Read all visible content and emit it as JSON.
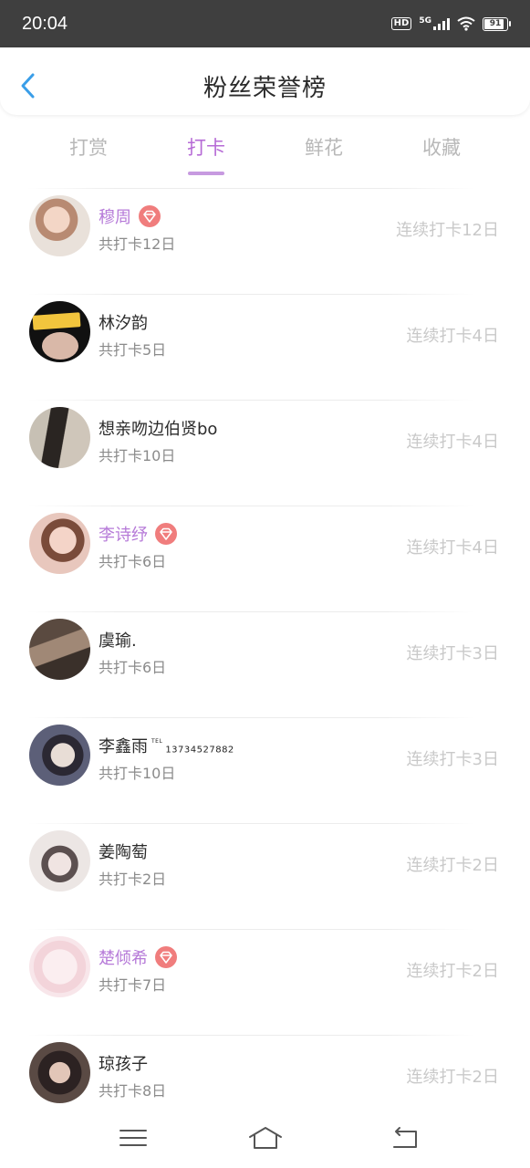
{
  "status_bar": {
    "time": "20:04",
    "network": "5G",
    "hd": "HD",
    "battery": "91"
  },
  "header": {
    "title": "粉丝荣誉榜"
  },
  "tabs": [
    {
      "label": "打赏",
      "active": false
    },
    {
      "label": "打卡",
      "active": true
    },
    {
      "label": "鲜花",
      "active": false
    },
    {
      "label": "收藏",
      "active": false
    }
  ],
  "fans": [
    {
      "name": "穆周",
      "vip": true,
      "total": "共打卡12日",
      "streak": "连续打卡12日"
    },
    {
      "name": "林汐韵",
      "vip": false,
      "total": "共打卡5日",
      "streak": "连续打卡4日"
    },
    {
      "name": "想亲吻边伯贤bo",
      "vip": false,
      "total": "共打卡10日",
      "streak": "连续打卡4日"
    },
    {
      "name": "李诗纾",
      "vip": true,
      "total": "共打卡6日",
      "streak": "连续打卡4日"
    },
    {
      "name": "虞瑜.",
      "vip": false,
      "total": "共打卡6日",
      "streak": "连续打卡3日"
    },
    {
      "name": "李鑫雨",
      "vip": false,
      "phone_prefix": "TEL",
      "phone": "13734527882",
      "total": "共打卡10日",
      "streak": "连续打卡3日"
    },
    {
      "name": "姜陶萄",
      "vip": false,
      "total": "共打卡2日",
      "streak": "连续打卡2日"
    },
    {
      "name": "楚倾希",
      "vip": true,
      "total": "共打卡7日",
      "streak": "连续打卡2日"
    },
    {
      "name": "琼孩子",
      "vip": false,
      "total": "共打卡8日",
      "streak": "连续打卡2日"
    }
  ],
  "colors": {
    "accent": "#b66bd6",
    "vip_name": "#b67ad8",
    "vip_badge": "#f07d7d",
    "back_arrow": "#3a9ee8"
  },
  "icons": {
    "back": "chevron-left-icon",
    "vip": "diamond-badge-icon",
    "menu": "menu-icon",
    "home": "home-icon",
    "back_nav": "return-icon"
  }
}
